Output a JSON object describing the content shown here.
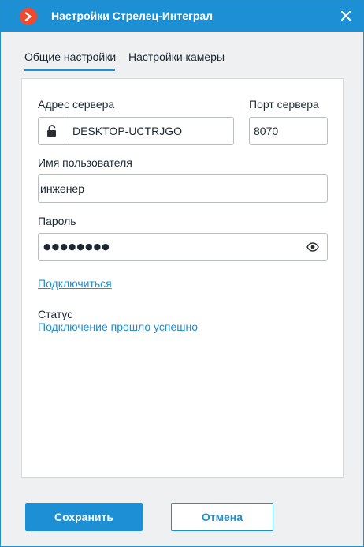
{
  "window": {
    "title": "Настройки Стрелец-Интеграл",
    "logo_icon": "macroscop-logo-icon",
    "close_icon": "close-icon"
  },
  "tabs": [
    {
      "label": "Общие настройки",
      "active": true
    },
    {
      "label": "Настройки камеры",
      "active": false
    }
  ],
  "form": {
    "server_address": {
      "label": "Адрес сервера",
      "value": "DESKTOP-UCTRJGO",
      "icon": "unlocked-padlock-icon"
    },
    "server_port": {
      "label": "Порт сервера",
      "value": "8070"
    },
    "username": {
      "label": "Имя пользователя",
      "value": "инженер"
    },
    "password": {
      "label": "Пароль",
      "masked_value": "●●●●●●●●",
      "icon": "eye-icon"
    },
    "connect_link": "Подключиться",
    "status": {
      "label": "Статус",
      "value": "Подключение прошло успешно"
    }
  },
  "buttons": {
    "save": "Сохранить",
    "cancel": "Отмена"
  },
  "colors": {
    "accent": "#1c8fd5",
    "logo": "#ef4a2e",
    "background": "#eef0f2"
  }
}
